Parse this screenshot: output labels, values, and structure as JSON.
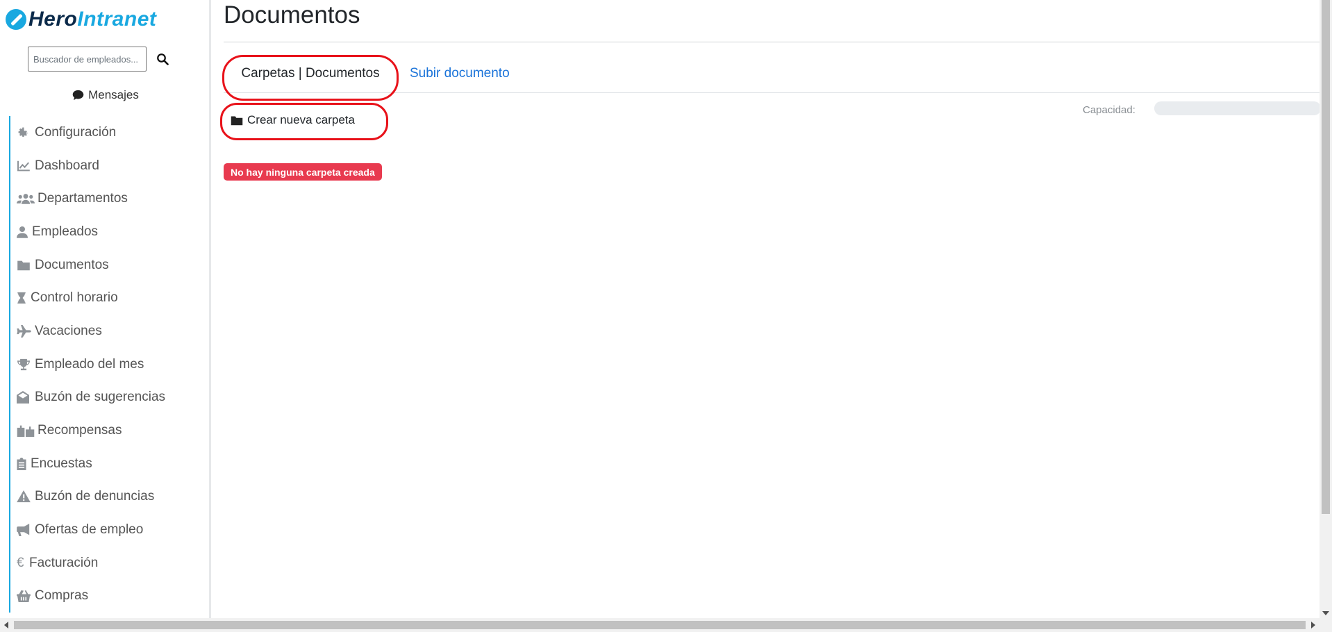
{
  "brand": {
    "part1": "Hero",
    "part2": "Intranet"
  },
  "search": {
    "placeholder": "Buscador de empleados..."
  },
  "messages": {
    "label": "Mensajes"
  },
  "sidebar": {
    "items": [
      {
        "label": "Configuración",
        "icon": "gear-icon"
      },
      {
        "label": "Dashboard",
        "icon": "chart-line-icon"
      },
      {
        "label": "Departamentos",
        "icon": "users-icon"
      },
      {
        "label": "Empleados",
        "icon": "user-icon"
      },
      {
        "label": "Documentos",
        "icon": "folder-icon"
      },
      {
        "label": "Control horario",
        "icon": "hourglass-icon"
      },
      {
        "label": "Vacaciones",
        "icon": "plane-icon"
      },
      {
        "label": "Empleado del mes",
        "icon": "trophy-icon"
      },
      {
        "label": "Buzón de sugerencias",
        "icon": "envelope-open-icon"
      },
      {
        "label": "Recompensas",
        "icon": "gifts-icon"
      },
      {
        "label": "Encuestas",
        "icon": "clipboard-list-icon"
      },
      {
        "label": "Buzón de denuncias",
        "icon": "warning-icon"
      },
      {
        "label": "Ofertas de empleo",
        "icon": "megaphone-icon"
      },
      {
        "label": "Facturación",
        "icon": "euro-icon"
      },
      {
        "label": "Compras",
        "icon": "basket-icon"
      }
    ]
  },
  "main": {
    "title": "Documentos",
    "tabs": [
      {
        "label": "Carpetas | Documentos"
      },
      {
        "label": "Subir documento"
      }
    ],
    "new_folder_label": "Crear nueva carpeta",
    "capacity_label": "Capacidad:",
    "capacity_used": 0,
    "empty_message": "No hay ninguna carpeta creada"
  },
  "colors": {
    "accent": "#19a8e0",
    "danger": "#e83a4f",
    "link": "#1a73d9",
    "highlight": "#e8121a"
  }
}
